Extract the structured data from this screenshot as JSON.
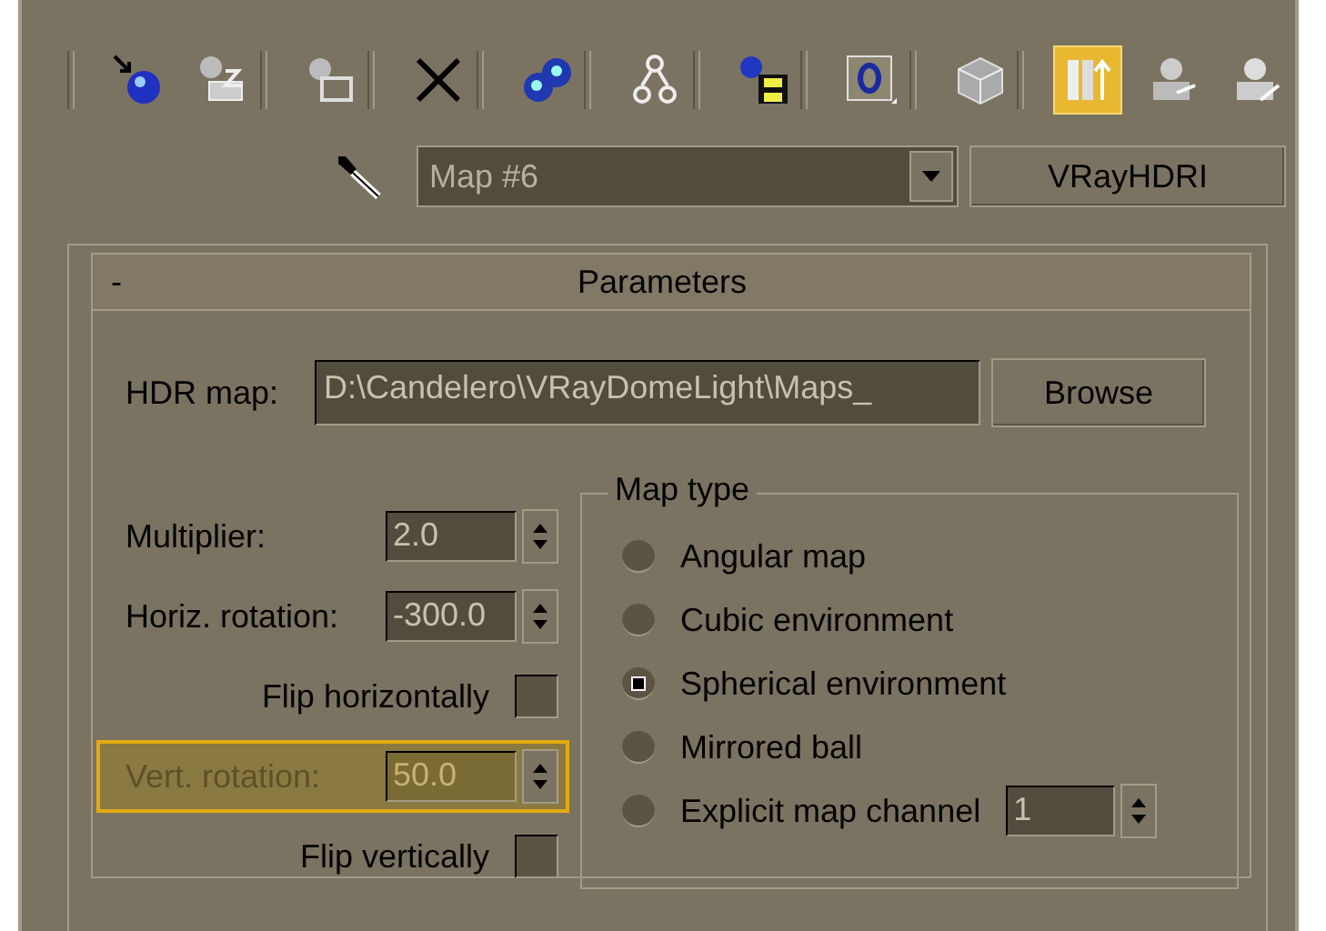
{
  "toolbar": {
    "groups": [
      [
        {
          "kind": "getmat",
          "selected": false
        },
        {
          "kind": "put",
          "selected": false
        }
      ],
      [
        {
          "kind": "assign",
          "selected": false
        }
      ],
      [
        {
          "kind": "reset",
          "selected": false
        }
      ],
      [
        {
          "kind": "copy",
          "selected": false
        }
      ],
      [
        {
          "kind": "tree",
          "selected": false
        }
      ],
      [
        {
          "kind": "save",
          "selected": false
        }
      ],
      [
        {
          "kind": "channel",
          "selected": false
        }
      ],
      [
        {
          "kind": "cube",
          "selected": false
        }
      ],
      [
        {
          "kind": "result",
          "selected": true
        },
        {
          "kind": "parent",
          "selected": false
        },
        {
          "kind": "sibling",
          "selected": false
        }
      ]
    ]
  },
  "map_bar": {
    "map_name": "Map #6",
    "map_type": "VRayHDRI"
  },
  "rollout": {
    "toggle": "-",
    "title": "Parameters",
    "hdr_map": {
      "label": "HDR map:",
      "value": "D:\\Candelero\\VRayDomeLight\\Maps_",
      "button": "Browse"
    },
    "controls": [
      {
        "kind": "spinner",
        "label": "Multiplier:",
        "value": "2.0",
        "highlighted": false
      },
      {
        "kind": "spinner",
        "label": "Horiz. rotation:",
        "value": "-300.0",
        "highlighted": false
      },
      {
        "kind": "checkbox",
        "label": "Flip horizontally",
        "checked": false,
        "highlighted": false
      },
      {
        "kind": "spinner",
        "label": "Vert. rotation:",
        "value": "50.0",
        "highlighted": true
      },
      {
        "kind": "checkbox",
        "label": "Flip vertically",
        "checked": false,
        "highlighted": false
      }
    ],
    "map_type": {
      "title": "Map type",
      "options": [
        {
          "label": "Angular map",
          "selected": false
        },
        {
          "label": "Cubic environment",
          "selected": false
        },
        {
          "label": "Spherical environment",
          "selected": true
        },
        {
          "label": "Mirrored ball",
          "selected": false
        },
        {
          "label": "Explicit map channel",
          "selected": false,
          "value": "1"
        }
      ]
    }
  }
}
